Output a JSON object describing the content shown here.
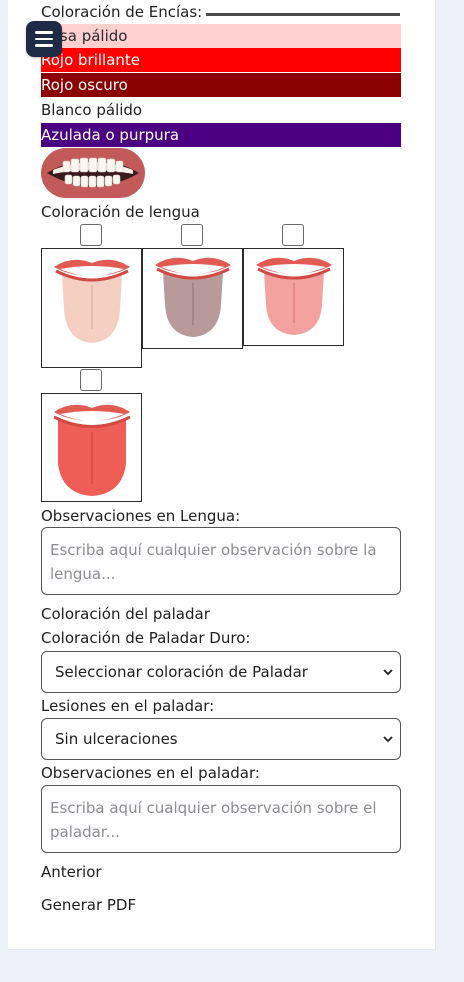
{
  "menu": {
    "icon": "hamburger-menu-icon"
  },
  "gums": {
    "label": "Coloración de Encías:",
    "options": [
      {
        "label": "Rosa pálido",
        "bg": "#ffd0d0",
        "fg": "#2a2a2a"
      },
      {
        "label": "Rojo brillante",
        "bg": "#ff0000",
        "fg": "#ffffff"
      },
      {
        "label": "Rojo oscuro",
        "bg": "#8b0000",
        "fg": "#ffffff"
      },
      {
        "label": "Blanco pálido",
        "bg": "#ffffff",
        "fg": "#1f1f1f"
      },
      {
        "label": "Azulada o purpura",
        "bg": "#4b0082",
        "fg": "#ffffff"
      }
    ]
  },
  "tongue": {
    "label": "Coloración de lengua",
    "images": [
      {
        "name": "pale-tongue",
        "color": "#f4cfc2"
      },
      {
        "name": "gray-tongue",
        "color": "#b89a9b"
      },
      {
        "name": "pink-tongue",
        "color": "#f3a2a0"
      },
      {
        "name": "red-tongue",
        "color": "#ee5d56"
      }
    ],
    "observations_label": "Observaciones en Lengua:",
    "observations_placeholder": "Escriba aquí cualquier observación sobre la lengua..."
  },
  "palate": {
    "section_label": "Coloración del paladar",
    "hard_label": "Coloración de Paladar Duro:",
    "hard_selected": "Seleccionar coloración de Paladar",
    "lesions_label": "Lesiones en el paladar:",
    "lesions_selected": "Sin ulceraciones",
    "observations_label": "Observaciones en el paladar:",
    "observations_placeholder": "Escriba aquí cualquier observación sobre el paladar..."
  },
  "nav": {
    "previous": "Anterior",
    "pdf": "Generar PDF"
  },
  "colors": {
    "page_bg": "#eef1f7",
    "menu_bg": "#1f2a44",
    "lip": "#e25b53",
    "teeth": "#ffffff"
  }
}
